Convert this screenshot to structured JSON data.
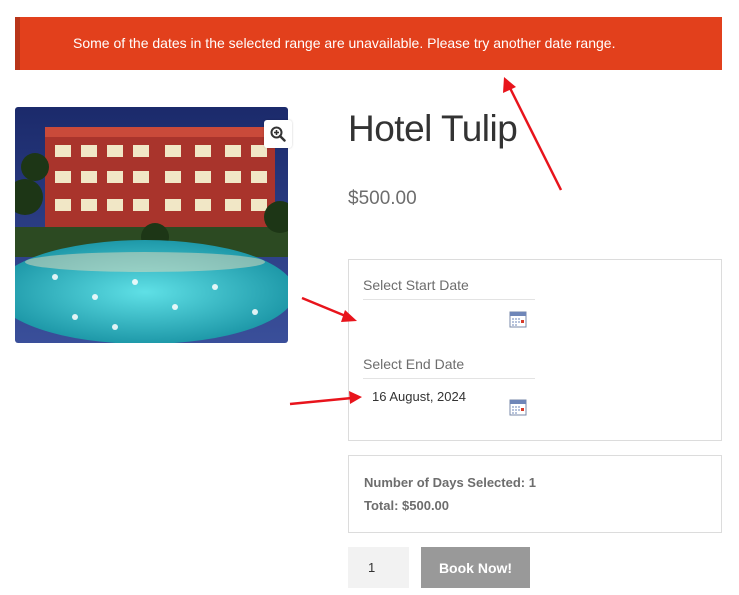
{
  "notice": {
    "message": "Some of the dates in the selected range are unavailable. Please try another date range."
  },
  "product": {
    "title": "Hotel Tulip",
    "price": "$500.00",
    "image_icon": "zoom-in-icon"
  },
  "booking": {
    "start_label": "Select Start Date",
    "start_value": "",
    "end_label": "Select End Date",
    "end_value": "16 August, 2024",
    "calendar_icon": "calendar-icon"
  },
  "summary": {
    "days": "Number of Days Selected: 1",
    "total": "Total: $500.00"
  },
  "cart": {
    "quantity": "1",
    "book_label": "Book Now!"
  },
  "colors": {
    "notice_bg": "#e2401c",
    "annotation_arrow": "#e8141c",
    "button_bg": "#999999"
  }
}
